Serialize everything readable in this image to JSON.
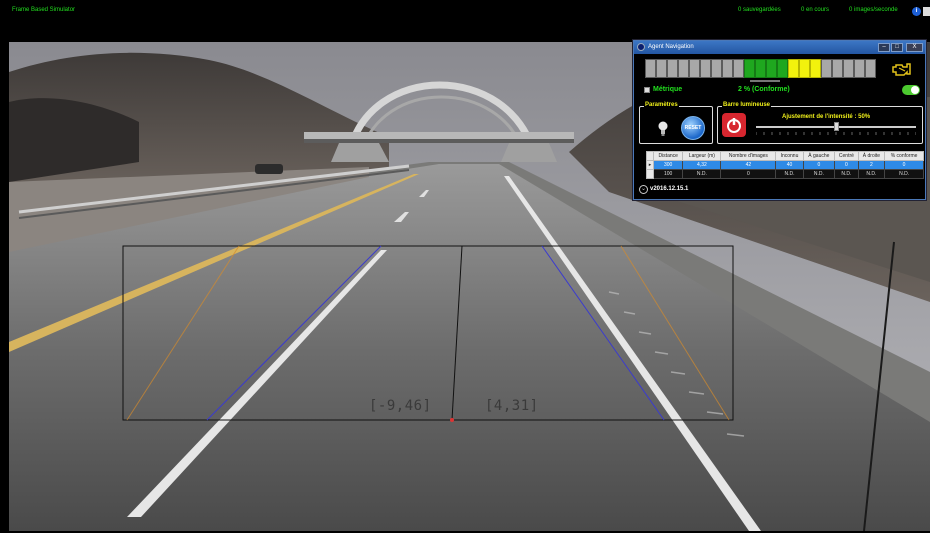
{
  "topbar": {
    "title": "Frame Based Simulator",
    "saved": "0 sauvegardées",
    "in_progress": "0 en cours",
    "fps": "0 images/seconde",
    "info_icon": "i"
  },
  "scene": {
    "coord_left": "[-9,46]",
    "coord_right": "[4,31]"
  },
  "window": {
    "title": "Agent Navigation",
    "minimize": "–",
    "maximize": "□",
    "close": "X",
    "segments": [
      "gray",
      "gray",
      "gray",
      "gray",
      "gray",
      "gray",
      "gray",
      "gray",
      "gray",
      "green",
      "green",
      "green",
      "green",
      "yellow",
      "yellow",
      "yellow",
      "gray",
      "gray",
      "gray",
      "gray",
      "gray"
    ],
    "metric_label": "Métrique",
    "conformity": "2 % (Conforme)",
    "params_legend": "Paramètres",
    "reset_label": "RESET",
    "light_legend": "Barre lumineuse",
    "intensity": "Ajustement de l'intensité : 50%",
    "intensity_value": 50,
    "table": {
      "headers": [
        "Distance",
        "Largeur (m)",
        "Nombre d'images",
        "Inconnu",
        "À gauche",
        "Centré",
        "À droite",
        "% conforme"
      ],
      "rows": [
        [
          "300",
          "4,32",
          "42",
          "40",
          "0",
          "0",
          "2",
          "0"
        ],
        [
          "100",
          "N.D.",
          "0",
          "N.D.",
          "N.D.",
          "N.D.",
          "N.D.",
          "N.D."
        ]
      ]
    },
    "version": "v2016.12.15.1"
  },
  "colors": {
    "status_green": "#22e01f",
    "label_yellow": "#f0f01a",
    "window_blue": "#2e6bbd",
    "selection_blue": "#2e8ae6"
  }
}
